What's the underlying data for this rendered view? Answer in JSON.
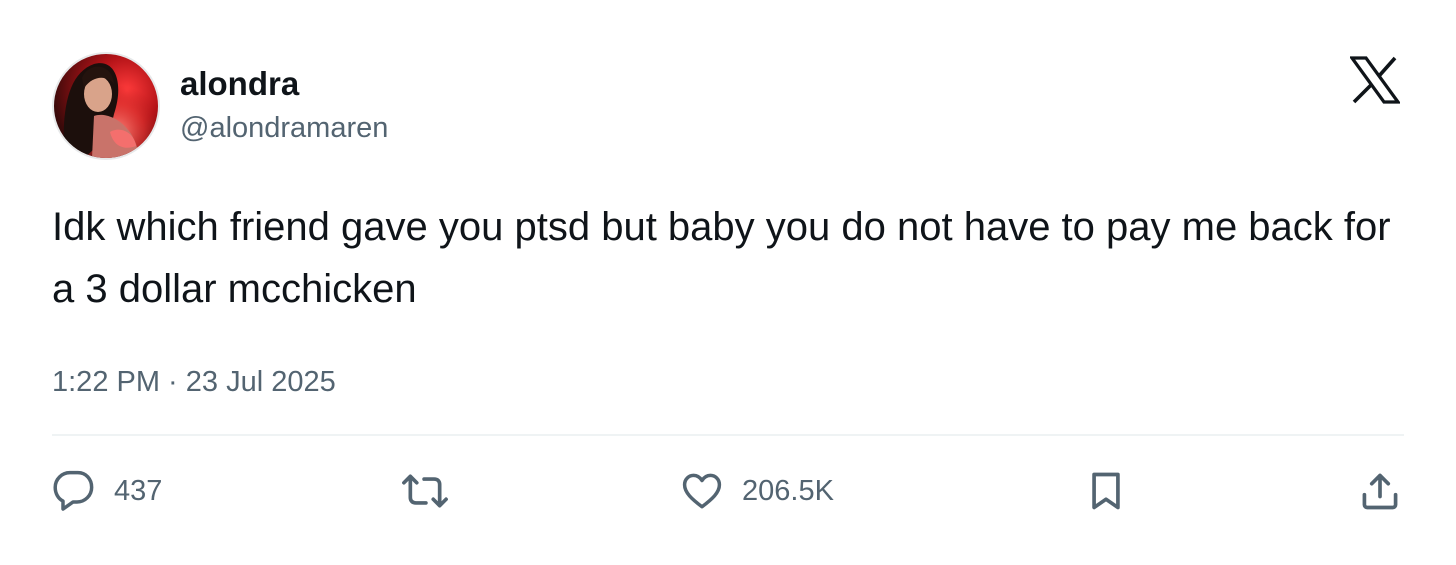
{
  "author": {
    "name": "alondra",
    "handle": "@alondramaren"
  },
  "brand_icon": "x-logo-icon",
  "tweet": {
    "text": "Idk which friend gave you ptsd but baby you do not have to pay me back for a 3 dollar mcchicken",
    "timestamp": "1:22 PM · 23 Jul 2025"
  },
  "actions": {
    "reply": {
      "icon": "reply-icon",
      "count": "437"
    },
    "retweet": {
      "icon": "retweet-icon"
    },
    "like": {
      "icon": "heart-icon",
      "count": "206.5K"
    },
    "bookmark": {
      "icon": "bookmark-icon"
    },
    "share": {
      "icon": "share-icon"
    }
  },
  "colors": {
    "text_primary": "#0f1419",
    "text_secondary": "#536471",
    "divider": "#eff3f4",
    "background": "#ffffff"
  }
}
